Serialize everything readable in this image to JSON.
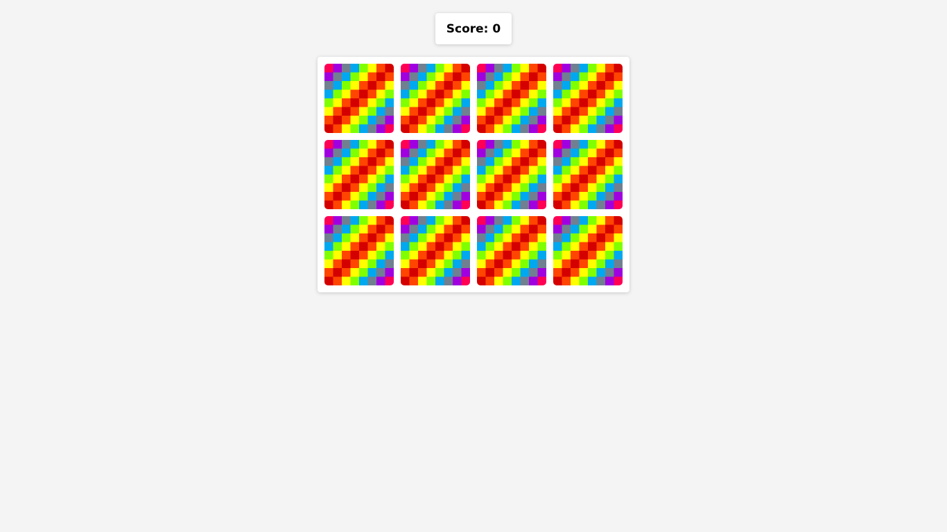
{
  "score": {
    "label": "Score: 0",
    "value": 0
  },
  "board": {
    "rows": 3,
    "cols": 4,
    "cards": [
      {
        "state": "face-down"
      },
      {
        "state": "face-down"
      },
      {
        "state": "face-down"
      },
      {
        "state": "face-down"
      },
      {
        "state": "face-down"
      },
      {
        "state": "face-down"
      },
      {
        "state": "face-down"
      },
      {
        "state": "face-down"
      },
      {
        "state": "face-down"
      },
      {
        "state": "face-down"
      },
      {
        "state": "face-down"
      },
      {
        "state": "face-down"
      }
    ]
  },
  "card_back": {
    "pattern": "diagonal-rainbow-checker",
    "palette": [
      "#d40000",
      "#ff4500",
      "#ffff00",
      "#7fff00",
      "#00a8f0",
      "#708090",
      "#a000e0",
      "#ff0055"
    ]
  },
  "colors": {
    "background": "#f4f4f4",
    "panel": "#ffffff",
    "text": "#000000"
  }
}
